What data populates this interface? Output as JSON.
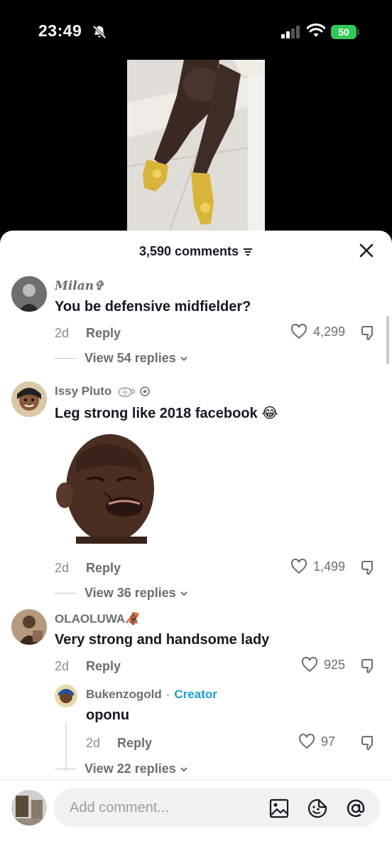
{
  "status_bar": {
    "time": "23:49",
    "battery": "50"
  },
  "sheet": {
    "comment_count": "3,590 comments"
  },
  "comments": [
    {
      "username": "Milan✞",
      "text": "You be defensive midfielder?",
      "time": "2d",
      "reply_label": "Reply",
      "likes": "4,299",
      "view_replies": "View 54 replies"
    },
    {
      "username": "Issy Pluto",
      "text": "Leg strong like 2018 facebook 😂",
      "time": "2d",
      "reply_label": "Reply",
      "likes": "1,499",
      "view_replies": "View 36 replies"
    },
    {
      "username": "OLAOLUWA🦧",
      "text": "Very strong and handsome lady",
      "time": "2d",
      "reply_label": "Reply",
      "likes": "925",
      "view_replies": "View 22 replies",
      "reply": {
        "username": "Bukenzogold",
        "separator": "·",
        "creator_tag": "Creator",
        "text": "oponu",
        "time": "2d",
        "reply_label": "Reply",
        "likes": "97"
      }
    }
  ],
  "input": {
    "placeholder": "Add comment..."
  },
  "icons": {
    "status": [
      "bell-slash-icon",
      "signal-icon",
      "wifi-icon"
    ],
    "input": [
      "image-icon",
      "emoji-icon",
      "mention-icon"
    ]
  }
}
